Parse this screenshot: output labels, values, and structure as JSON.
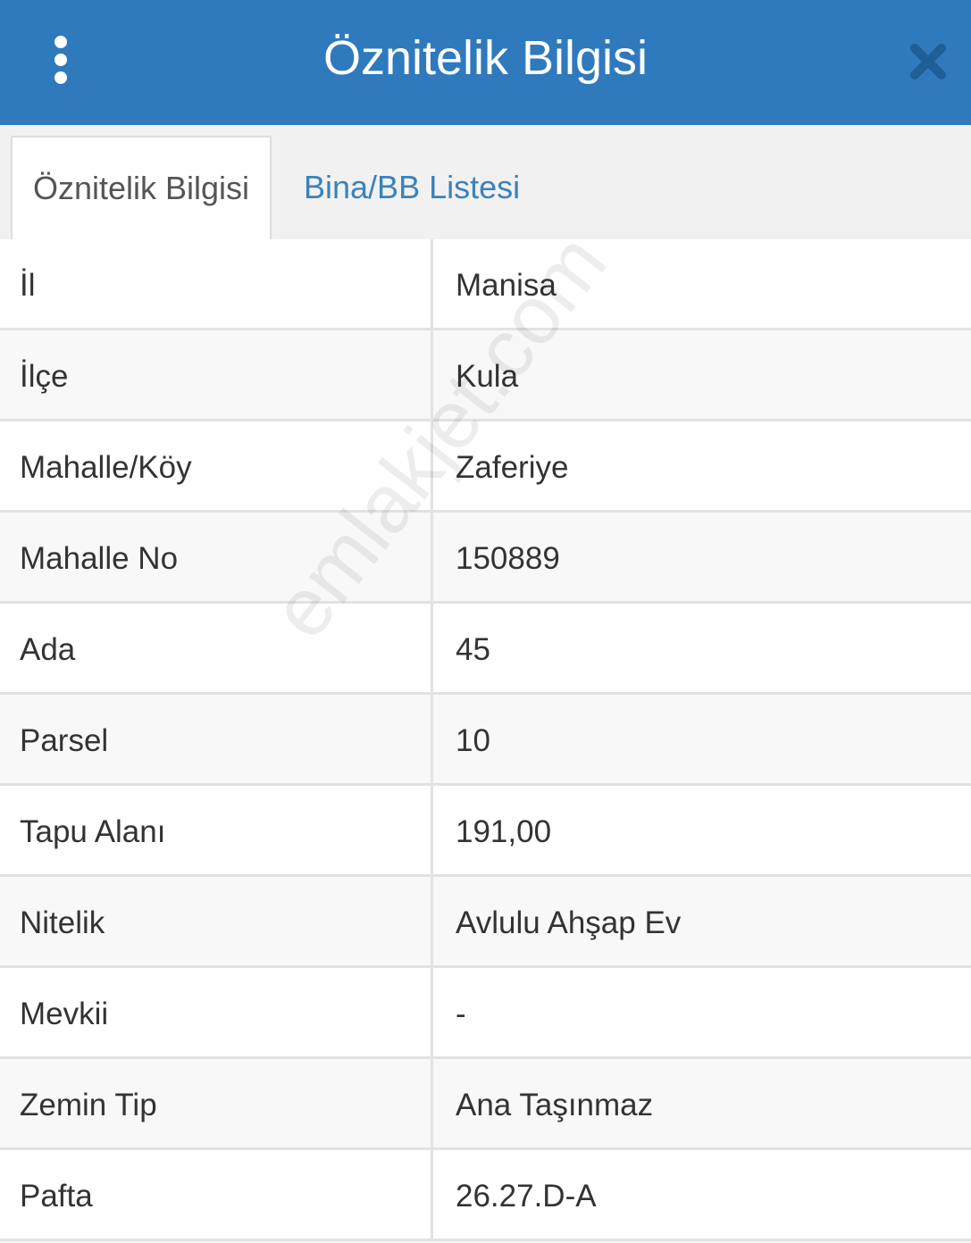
{
  "header": {
    "title": "Öznitelik Bilgisi",
    "menu_icon": "vertical-dots-icon",
    "close_icon": "close-icon",
    "background_color": "#2f79bd"
  },
  "tabs": [
    {
      "label": "Öznitelik Bilgisi",
      "active": true
    },
    {
      "label": "Bina/BB Listesi",
      "active": false,
      "color": "#3a82b9"
    }
  ],
  "attributes": [
    {
      "key": "İl",
      "value": "Manisa"
    },
    {
      "key": "İlçe",
      "value": "Kula"
    },
    {
      "key": "Mahalle/Köy",
      "value": "Zaferiye"
    },
    {
      "key": "Mahalle No",
      "value": "150889"
    },
    {
      "key": "Ada",
      "value": "45"
    },
    {
      "key": "Parsel",
      "value": "10"
    },
    {
      "key": "Tapu Alanı",
      "value": "191,00"
    },
    {
      "key": "Nitelik",
      "value": "Avlulu Ahşap Ev"
    },
    {
      "key": "Mevkii",
      "value": "-"
    },
    {
      "key": "Zemin Tip",
      "value": "Ana Taşınmaz"
    },
    {
      "key": "Pafta",
      "value": "26.27.D-A"
    }
  ],
  "watermark": "emlakjet.com"
}
